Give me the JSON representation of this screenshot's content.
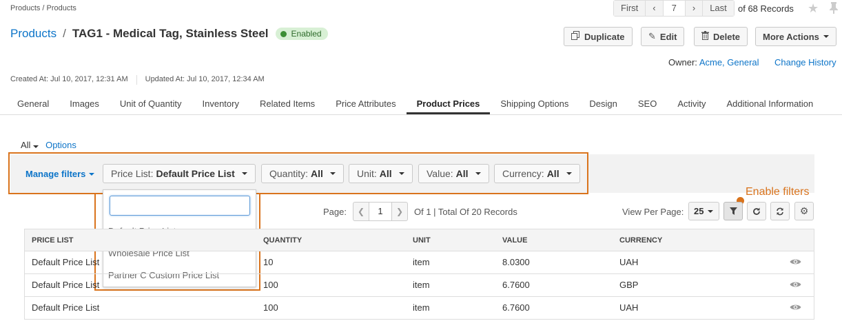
{
  "breadcrumb": [
    "Products",
    "/",
    "Products"
  ],
  "pager_top": {
    "first": "First",
    "prev": "‹",
    "page": "7",
    "next": "›",
    "last": "Last",
    "of_records": "of 68 Records"
  },
  "title": {
    "section": "Products",
    "separator": "/",
    "name": "TAG1 - Medical Tag, Stainless Steel",
    "status": "Enabled"
  },
  "actions": {
    "duplicate": "Duplicate",
    "edit": "Edit",
    "delete": "Delete",
    "more": "More Actions"
  },
  "owner": {
    "label": "Owner:",
    "value": "Acme, General",
    "change_history": "Change History"
  },
  "meta": {
    "created": "Created At: Jul 10, 2017, 12:31 AM",
    "updated": "Updated At: Jul 10, 2017, 12:34 AM"
  },
  "tabs": [
    "General",
    "Images",
    "Unit of Quantity",
    "Inventory",
    "Related Items",
    "Price Attributes",
    "Product Prices",
    "Shipping Options",
    "Design",
    "SEO",
    "Activity",
    "Additional Information"
  ],
  "active_tab": "Product Prices",
  "view": {
    "all": "All",
    "options": "Options"
  },
  "filters": {
    "manage": "Manage filters",
    "price_list": {
      "label": "Price List:",
      "value": "Default Price List"
    },
    "quantity": {
      "label": "Quantity:",
      "value": "All"
    },
    "unit": {
      "label": "Unit:",
      "value": "All"
    },
    "value": {
      "label": "Value:",
      "value": "All"
    },
    "currency": {
      "label": "Currency:",
      "value": "All"
    }
  },
  "dropdown": {
    "search_value": "",
    "options": [
      "Default Price List",
      "Wholesale Price List",
      "Partner C Custom Price List"
    ]
  },
  "annotation": {
    "text": "Enable filters",
    "color": "#d9731c"
  },
  "pagination": {
    "page_label": "Page:",
    "page": "1",
    "summary": "Of 1 | Total Of 20 Records",
    "view_per_page_label": "View Per Page:",
    "per_page": "25"
  },
  "table": {
    "columns": [
      "PRICE LIST",
      "QUANTITY",
      "UNIT",
      "VALUE",
      "CURRENCY"
    ],
    "rows": [
      [
        "Default Price List",
        "10",
        "item",
        "8.0300",
        "UAH"
      ],
      [
        "Default Price List",
        "100",
        "item",
        "6.7600",
        "GBP"
      ],
      [
        "Default Price List",
        "100",
        "item",
        "6.7600",
        "UAH"
      ]
    ]
  }
}
